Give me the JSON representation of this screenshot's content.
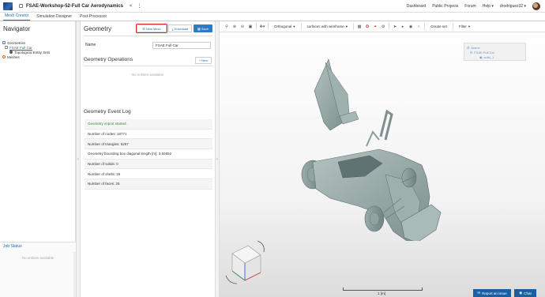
{
  "header": {
    "project_title": "FSAE-Workshop-52-Full Car Aerodynamics",
    "nav_links": [
      "Dashboard",
      "Public Projects",
      "Forum",
      "Help ▾",
      "drodriguez32 ▾"
    ]
  },
  "tabs": [
    "Mesh Creator",
    "Simulation Designer",
    "Post-Processor"
  ],
  "navigator": {
    "title": "Navigator",
    "tree": {
      "geometries": "Geometries",
      "geometry_item": "FSAE Full Car",
      "entity_sets": "Topological Entity Sets",
      "meshes": "Meshes"
    },
    "job_status_title": "Job Status",
    "job_empty": "No entities available"
  },
  "geometry_panel": {
    "title": "Geometry",
    "new_mesh_label": "New Mesh",
    "download_label": "Download",
    "save_label": "Save",
    "name_label": "Name",
    "name_value": "FSAE Full Car",
    "operations_title": "Geometry Operations",
    "new_label": "New",
    "operations_empty": "No entities available",
    "event_log_title": "Geometry Event Log",
    "event_log": [
      "Geometry import started.",
      "Number of nodes: 18771",
      "Number of triangles: 6257",
      "Geometry bounding box diagonal length [m]: 3.50852",
      "Number of solids: 0",
      "Number of shells: 26",
      "Number of faces: 26"
    ]
  },
  "viewer": {
    "projection": "Orthogonal",
    "render_mode": "surfaces with wireframe",
    "create_set": "Create set",
    "filter": "Filter",
    "scene_tree": [
      "Scene",
      "FSAE Full Car",
      "solid_1"
    ],
    "scale_label": "1 [m]"
  },
  "footer": {
    "report_label": "Report an issue",
    "chat_label": "Chat"
  },
  "colors": {
    "accent": "#1a6bb8",
    "save_button": "#2f79c5",
    "highlight_outline": "#d9262b",
    "car_body": "#8fa3a1"
  }
}
